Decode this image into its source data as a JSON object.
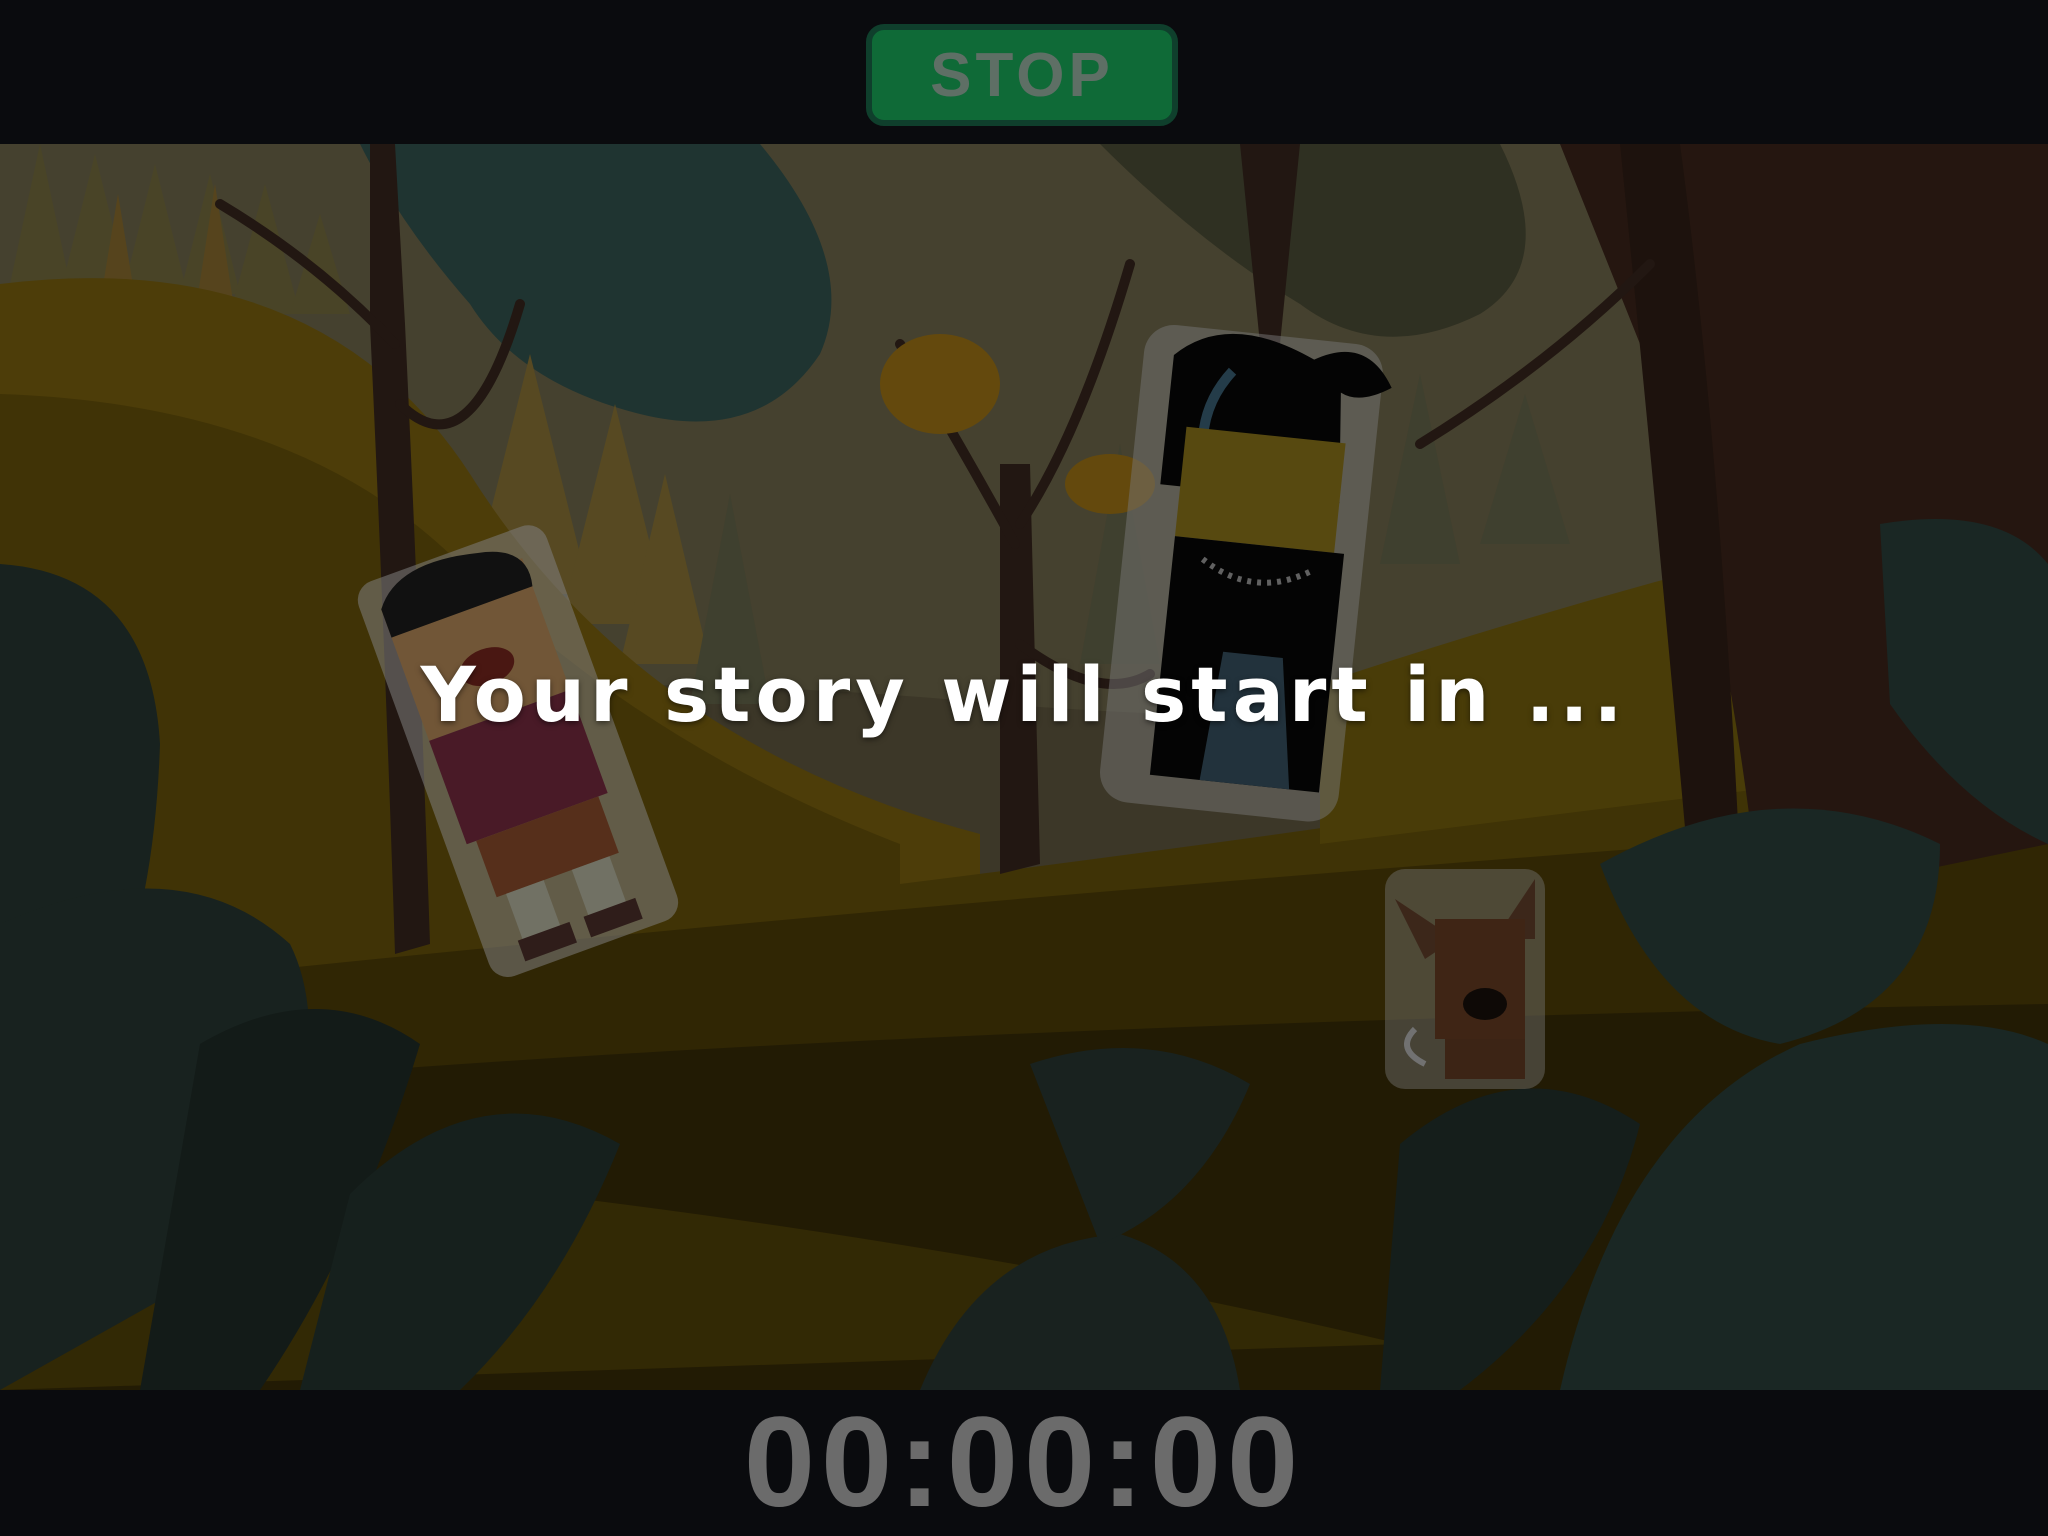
{
  "toolbar": {
    "stop_label": "STOP"
  },
  "overlay": {
    "message": "Your story will start in ..."
  },
  "footer": {
    "timer": "00:00:00"
  },
  "colors": {
    "stop_button": "#0f6a37",
    "stop_button_border": "#0f3f2c",
    "timer_text": "#6b6b6b",
    "bar_background": "#0a0b0e"
  },
  "scene": {
    "background": "dimmed cartoon forest",
    "characters": [
      "boy-character",
      "woman-character",
      "dog-character"
    ]
  }
}
